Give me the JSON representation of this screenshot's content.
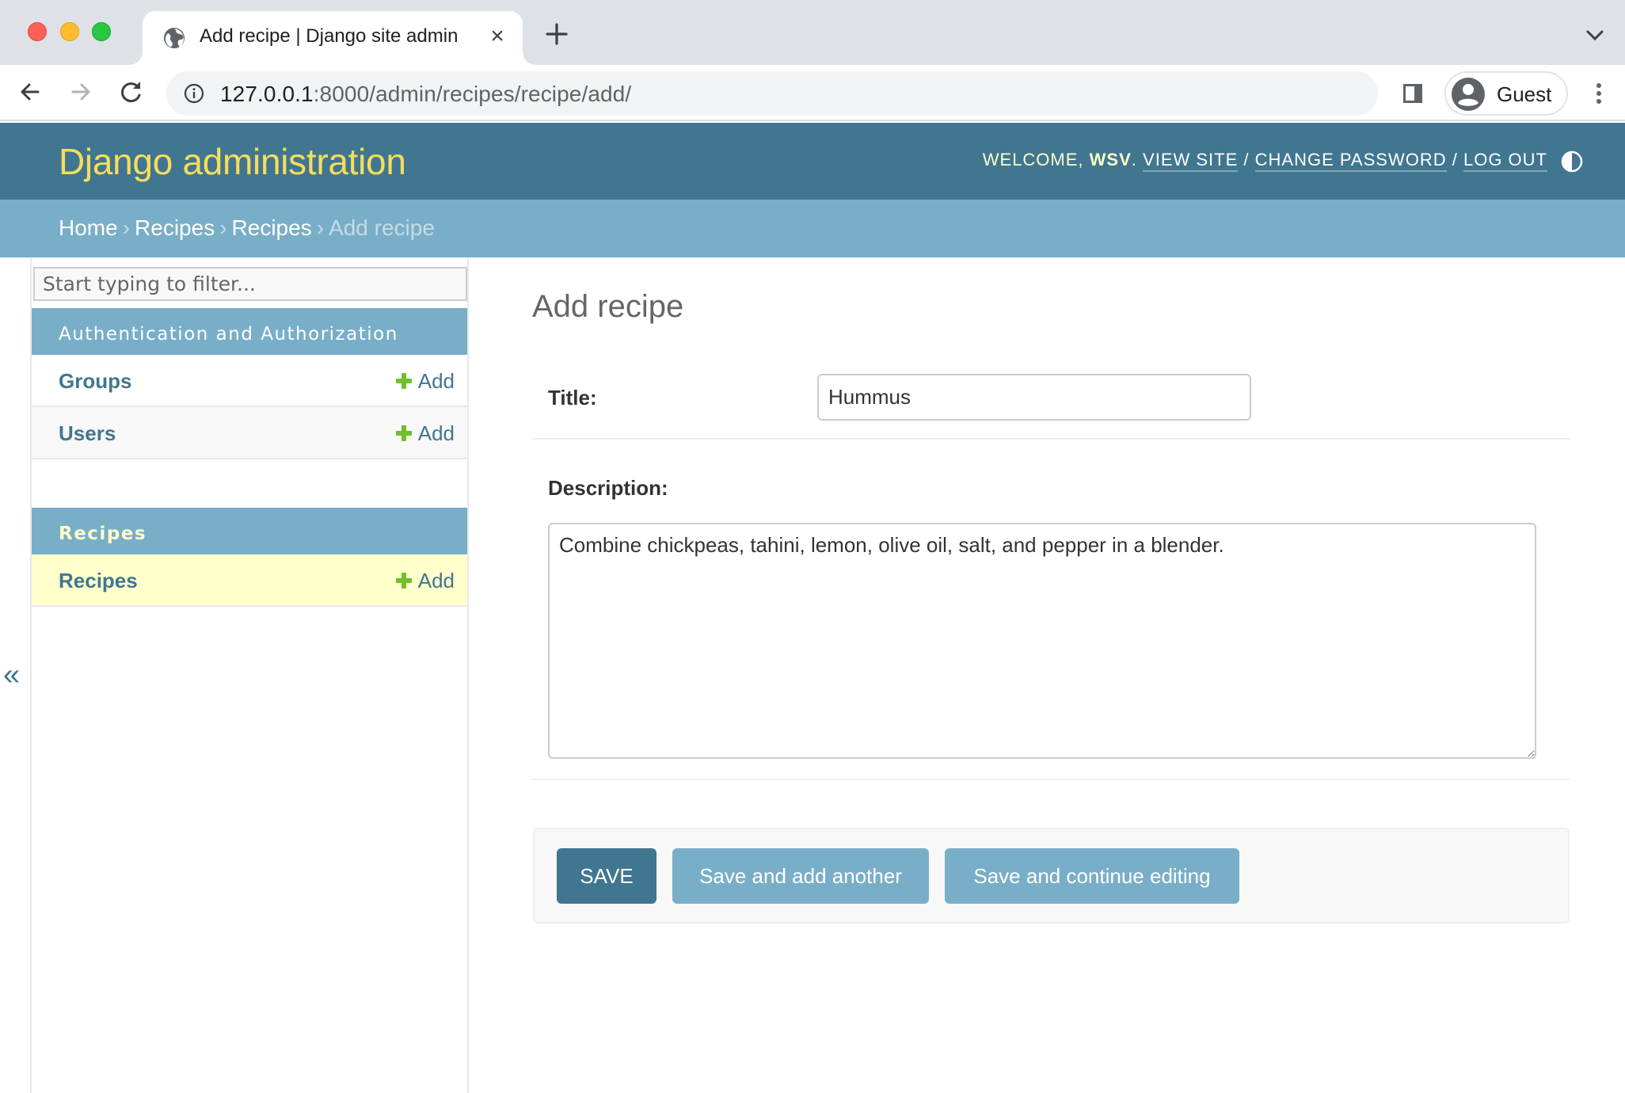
{
  "browser": {
    "tab": {
      "title": "Add recipe | Django site admin",
      "favicon": "globe-icon",
      "close_glyph": "×"
    },
    "url": {
      "host": "127.0.0.1",
      "rest": ":8000/admin/recipes/recipe/add/"
    },
    "profile": {
      "name": "Guest"
    }
  },
  "header": {
    "brand": "Django administration",
    "welcome": "Welcome,",
    "username": "WSV",
    "links": {
      "view_site": "View site",
      "change_password": "Change password",
      "log_out": "Log out"
    },
    "separator": "/"
  },
  "breadcrumbs": {
    "items": [
      "Home",
      "Recipes",
      "Recipes"
    ],
    "current": "Add recipe",
    "separator": "›"
  },
  "sidebar": {
    "collapse_glyph": "«",
    "filter_placeholder": "Start typing to filter...",
    "modules": [
      {
        "caption": "Authentication and Authorization",
        "models": [
          {
            "name": "Groups",
            "add_label": "Add"
          },
          {
            "name": "Users",
            "add_label": "Add"
          }
        ]
      },
      {
        "caption": "Recipes",
        "models": [
          {
            "name": "Recipes",
            "add_label": "Add",
            "current": true
          }
        ]
      }
    ]
  },
  "main": {
    "title": "Add recipe",
    "fields": {
      "title": {
        "label": "Title:",
        "value": "Hummus"
      },
      "description": {
        "label": "Description:",
        "value": "Combine chickpeas, tahini, lemon, olive oil, salt, and pepper in a blender."
      }
    },
    "buttons": {
      "save": "Save",
      "save_add_another": "Save and add another",
      "save_continue": "Save and continue editing"
    }
  },
  "colors": {
    "header_bg": "#417690",
    "breadcrumb_bg": "#79aec8",
    "brand_text": "#f5dd5d",
    "current_row_bg": "#ffffcc",
    "add_icon": "#70bf2b"
  }
}
